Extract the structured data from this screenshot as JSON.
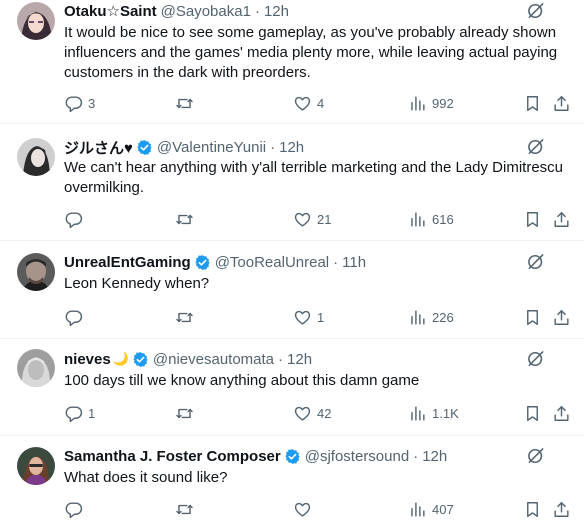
{
  "tweets": [
    {
      "name": "Otaku☆Saint",
      "handle": "@Sayobaka1",
      "time": "12h",
      "text": "It would be nice to see some gameplay, as you've probably already shown influencers and the games' media plenty more, while leaving actual paying customers in the dark with preorders.",
      "replies": "3",
      "retweets": "",
      "likes": "4",
      "views": "992"
    },
    {
      "name": "ジルさん♥",
      "handle": "@ValentineYunii",
      "time": "12h",
      "text": "We can't hear anything with y'all terrible marketing and the Lady Dimitrescu overmilking.",
      "replies": "",
      "retweets": "",
      "likes": "21",
      "views": "616"
    },
    {
      "name": "UnrealEntGaming",
      "handle": "@TooRealUnreal",
      "time": "11h",
      "text": "Leon Kennedy when?",
      "replies": "",
      "retweets": "",
      "likes": "1",
      "views": "226"
    },
    {
      "name": "nieves",
      "handle": "@nievesautomata",
      "time": "12h",
      "text": "100 days till we know anything about this damn game",
      "replies": "1",
      "retweets": "",
      "likes": "42",
      "views": "1.1K"
    },
    {
      "name": "Samantha J. Foster Composer",
      "handle": "@sjfostersound",
      "time": "12h",
      "text": "What does it sound like?",
      "replies": "",
      "retweets": "",
      "likes": "",
      "views": "407"
    }
  ],
  "colors": {
    "text": "#0f1419",
    "secondary": "#536471",
    "verified": "#1d9bf0",
    "divider": "#eff3f4"
  },
  "icons": [
    "reply-icon",
    "retweet-icon",
    "like-icon",
    "views-icon",
    "bookmark-icon",
    "share-icon",
    "grok-icon",
    "verified-badge-icon"
  ]
}
